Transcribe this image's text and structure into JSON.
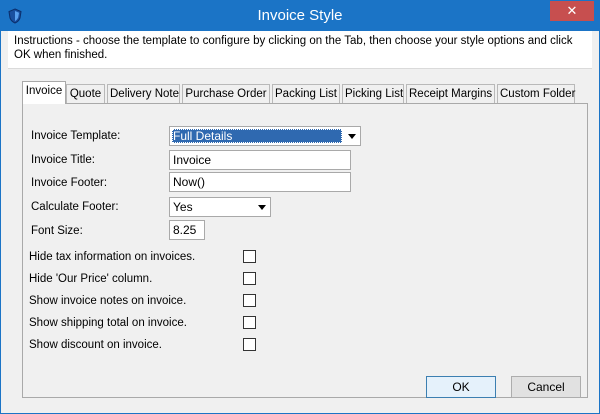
{
  "window": {
    "title": "Invoice Style",
    "close_label": "✕"
  },
  "instructions": "Instructions - choose the template to configure by clicking on the Tab, then choose your style options and click OK when finished.",
  "tabs": [
    {
      "label": "Invoice",
      "active": true
    },
    {
      "label": "Quote"
    },
    {
      "label": "Delivery Note"
    },
    {
      "label": "Purchase Order"
    },
    {
      "label": "Packing List"
    },
    {
      "label": "Picking List"
    },
    {
      "label": "Receipt Margins"
    },
    {
      "label": "Custom Folder"
    }
  ],
  "form": {
    "template_label": "Invoice Template:",
    "template_value": "Full Details",
    "title_label": "Invoice Title:",
    "title_value": "Invoice",
    "footer_label": "Invoice Footer:",
    "footer_value": "Now()",
    "calc_footer_label": "Calculate Footer:",
    "calc_footer_value": "Yes",
    "font_size_label": "Font Size:",
    "font_size_value": "8.25"
  },
  "checkboxes": [
    {
      "label": "Hide tax information on invoices.",
      "checked": false
    },
    {
      "label": "Hide 'Our Price' column.",
      "checked": false
    },
    {
      "label": "Show invoice notes on invoice.",
      "checked": false
    },
    {
      "label": "Show shipping total on invoice.",
      "checked": false
    },
    {
      "label": "Show discount on invoice.",
      "checked": false
    }
  ],
  "buttons": {
    "ok": "OK",
    "cancel": "Cancel"
  },
  "colors": {
    "titlebar": "#1b74c6",
    "close": "#c74f4f",
    "selection": "#2f69b0"
  }
}
